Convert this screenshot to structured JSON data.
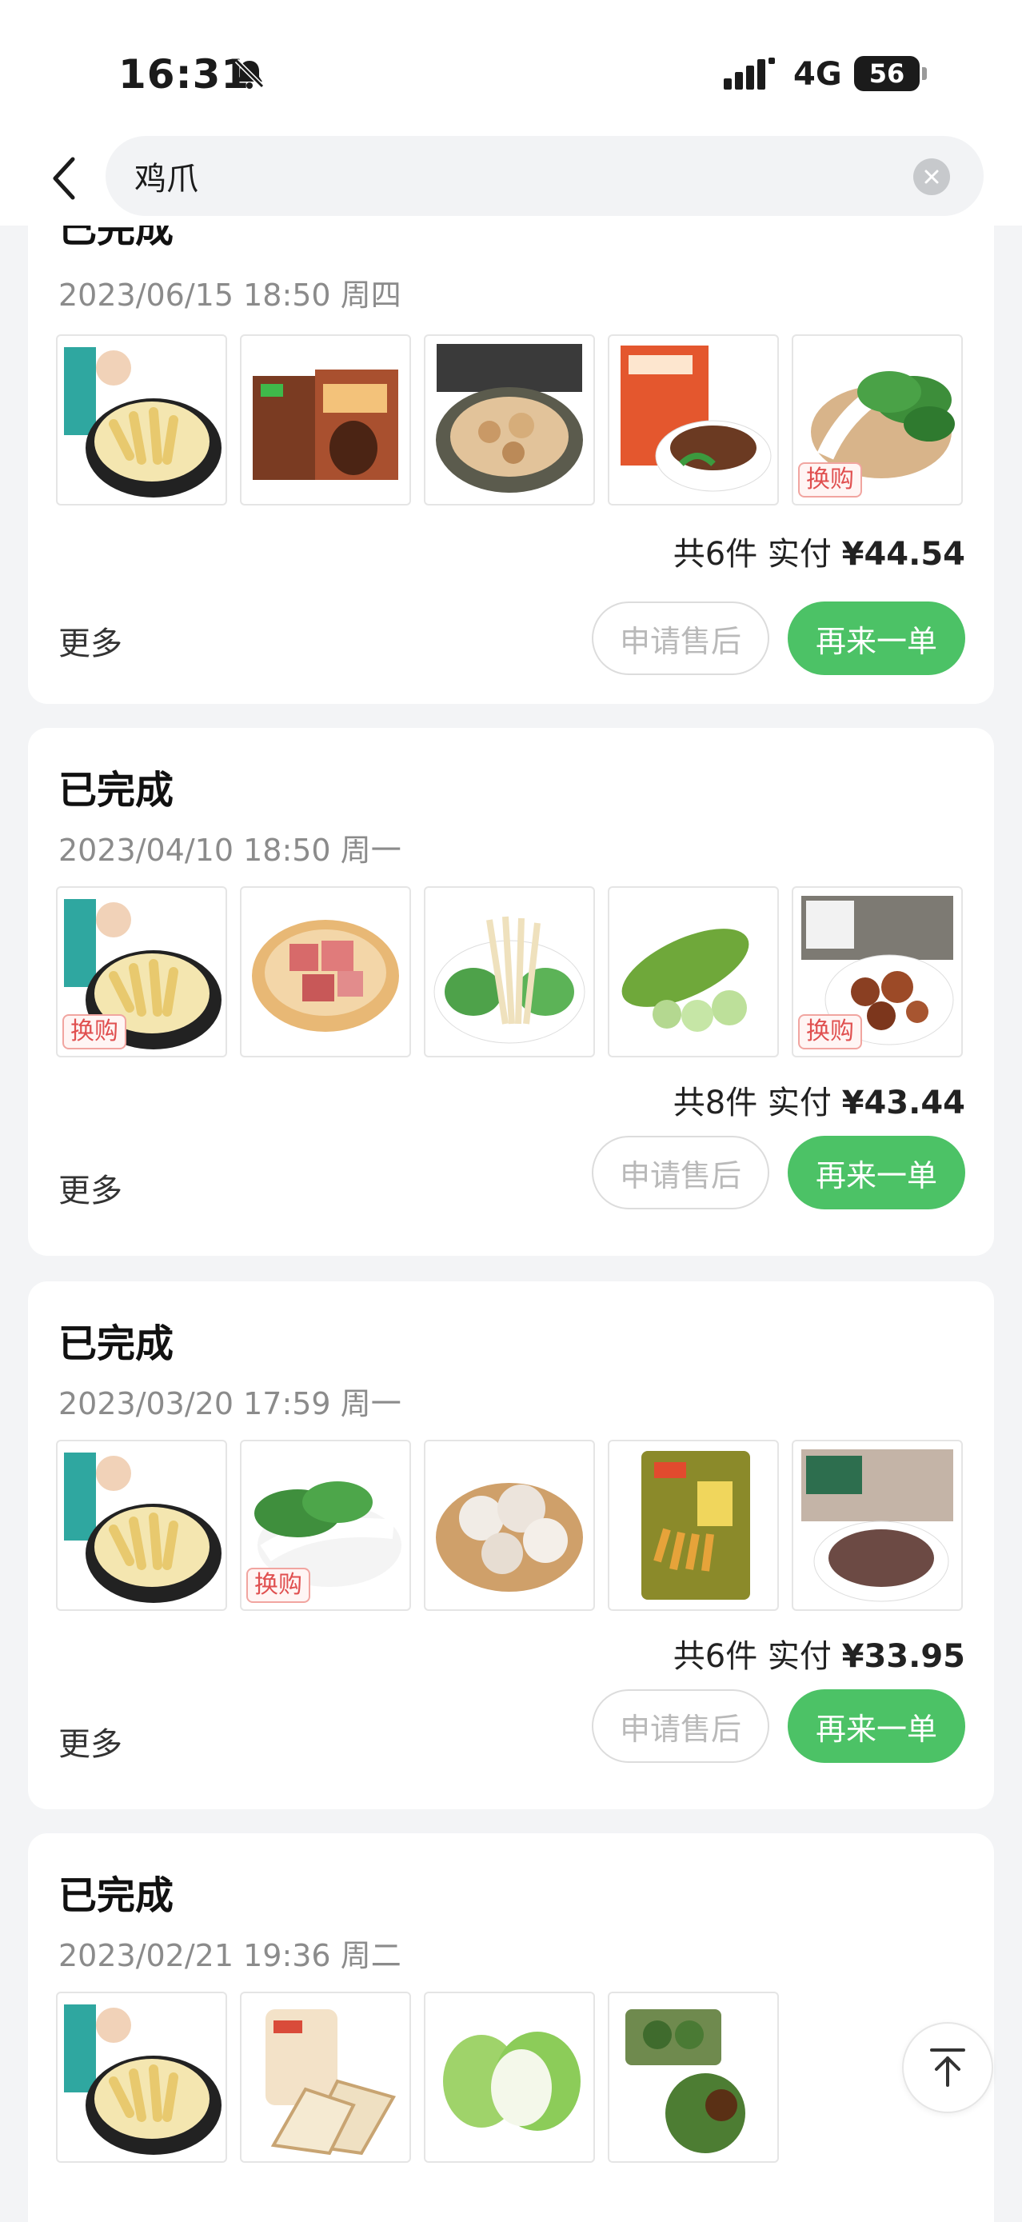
{
  "status_bar": {
    "time": "16:31",
    "network": "4G",
    "battery": "56",
    "icons": [
      "bell-slash-icon",
      "signal-icon"
    ]
  },
  "search": {
    "query": "鸡爪",
    "back_icon": "chevron-left-icon",
    "clear_icon": "clear-icon"
  },
  "orders": [
    {
      "status": "已完成",
      "date": "2023/06/15 18:50 周四",
      "products": [
        {
          "name": "chicken-feet",
          "tag": ""
        },
        {
          "name": "ice-cream-box",
          "tag": ""
        },
        {
          "name": "chicken-dish",
          "tag": ""
        },
        {
          "name": "beef-pack",
          "tag": ""
        },
        {
          "name": "bok-choy",
          "tag": "换购"
        }
      ],
      "count_text": "共6件",
      "paid_label": "实付",
      "amount": "¥44.54",
      "more": "更多",
      "aftersale_label": "申请售后",
      "reorder_label": "再来一单"
    },
    {
      "status": "已完成",
      "date": "2023/04/10 18:50 周一",
      "products": [
        {
          "name": "chicken-feet",
          "tag": "换购"
        },
        {
          "name": "pork-cubes",
          "tag": ""
        },
        {
          "name": "enoki-mushroom",
          "tag": ""
        },
        {
          "name": "bitter-melon",
          "tag": ""
        },
        {
          "name": "spare-ribs",
          "tag": "换购"
        }
      ],
      "count_text": "共8件",
      "paid_label": "实付",
      "amount": "¥43.44",
      "more": "更多",
      "aftersale_label": "申请售后",
      "reorder_label": "再来一单"
    },
    {
      "status": "已完成",
      "date": "2023/03/20 17:59 周一",
      "products": [
        {
          "name": "chicken-feet",
          "tag": ""
        },
        {
          "name": "bok-choy",
          "tag": "换购"
        },
        {
          "name": "garlic",
          "tag": ""
        },
        {
          "name": "snack-bag",
          "tag": ""
        },
        {
          "name": "minced-beef",
          "tag": ""
        }
      ],
      "count_text": "共6件",
      "paid_label": "实付",
      "amount": "¥33.95",
      "more": "更多",
      "aftersale_label": "申请售后",
      "reorder_label": "再来一单"
    },
    {
      "status": "已完成",
      "date": "2023/02/21 19:36 周二",
      "products": [
        {
          "name": "chicken-feet",
          "tag": ""
        },
        {
          "name": "bread",
          "tag": ""
        },
        {
          "name": "guava",
          "tag": ""
        },
        {
          "name": "green-rice-cakes",
          "tag": ""
        }
      ],
      "count_text": "",
      "paid_label": "",
      "amount": "",
      "more": "",
      "aftersale_label": "",
      "reorder_label": ""
    }
  ],
  "back_to_top_icon": "arrow-up-to-top-icon"
}
